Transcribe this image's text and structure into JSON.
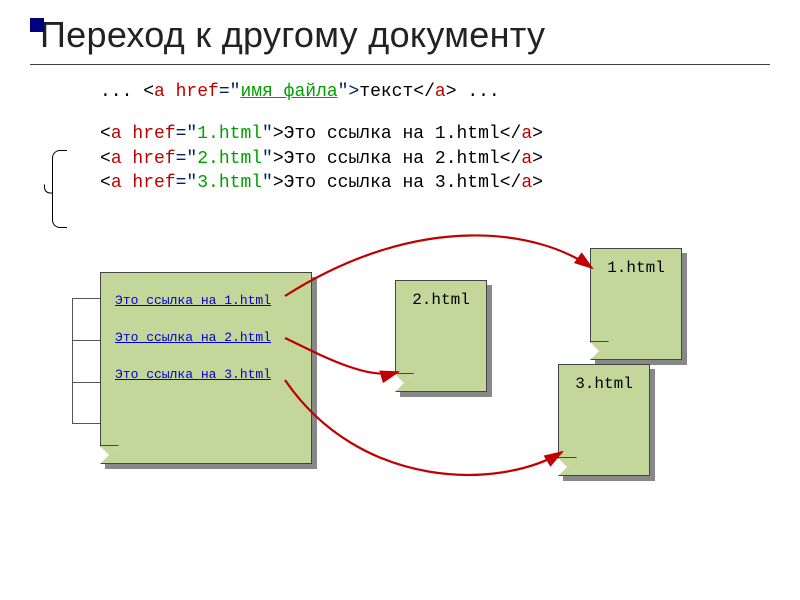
{
  "title": "Переход к другому документу",
  "syntax": {
    "prefix": "... <",
    "a": "a",
    "href": " href",
    "eq": "=\"",
    "filename": "имя_файла",
    "after_file": "\">",
    "linktext": "текст",
    "close": "</",
    "a2": "a",
    "end": "> ..."
  },
  "examples": [
    {
      "file": "1.html",
      "text": "Это ссылка на 1.html"
    },
    {
      "file": "2.html",
      "text": "Это ссылка на 2.html"
    },
    {
      "file": "3.html",
      "text": "Это ссылка на 3.html"
    }
  ],
  "main_doc_links": [
    "Это ссылка на 1.html",
    "Это ссылка на 2.html",
    "Это ссылка на 3.html"
  ],
  "targets": {
    "d1": "1.html",
    "d2": "2.html",
    "d3": "3.html"
  },
  "colors": {
    "doc_fill": "#c4d79b",
    "link": "#0000cc",
    "arrow": "#c00000"
  }
}
